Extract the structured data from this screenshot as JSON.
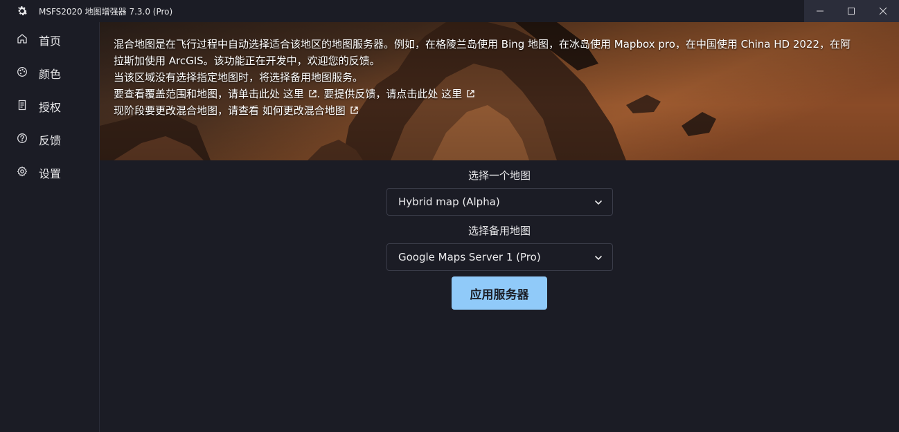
{
  "titlebar": {
    "title": "MSFS2020 地图增强器 7.3.0 (Pro)",
    "icon": "gear-icon"
  },
  "window_controls": [
    "minimize-icon",
    "maximize-icon",
    "close-icon"
  ],
  "sidebar": {
    "items": [
      {
        "label": "首页",
        "icon": "home-icon"
      },
      {
        "label": "颜色",
        "icon": "palette-icon"
      },
      {
        "label": "授权",
        "icon": "license-icon"
      },
      {
        "label": "反馈",
        "icon": "help-circle-icon"
      },
      {
        "label": "设置",
        "icon": "gear-icon"
      }
    ]
  },
  "banner": {
    "line1": "混合地图是在飞行过程中自动选择适合该地区的地图服务器。例如，在格陵兰岛使用 Bing 地图，在冰岛使用 Mapbox pro，在中国使用 China HD 2022，在阿",
    "line2": "拉斯加使用 ArcGIS。该功能正在开发中，欢迎您的反馈。",
    "line3": "当该区域没有选择指定地图时，将选择备用地图服务。",
    "line4_prefix": "要查看覆盖范围和地图，请单击此处 ",
    "line4_link1": "这里",
    "line4_mid": ". 要提供反馈，请点击此处 ",
    "line4_link2": "这里",
    "line5_prefix": "现阶段要更改混合地图，请查看 ",
    "line5_link": "如何更改混合地图"
  },
  "form": {
    "map_label": "选择一个地图",
    "map_value": "Hybrid map (Alpha)",
    "backup_label": "选择备用地图",
    "backup_value": "Google Maps Server 1 (Pro)",
    "apply_label": "应用服务器"
  },
  "colors": {
    "background": "#1b1c25",
    "accent": "#90caf9",
    "window_controls_bg": "#2b2d3a"
  }
}
